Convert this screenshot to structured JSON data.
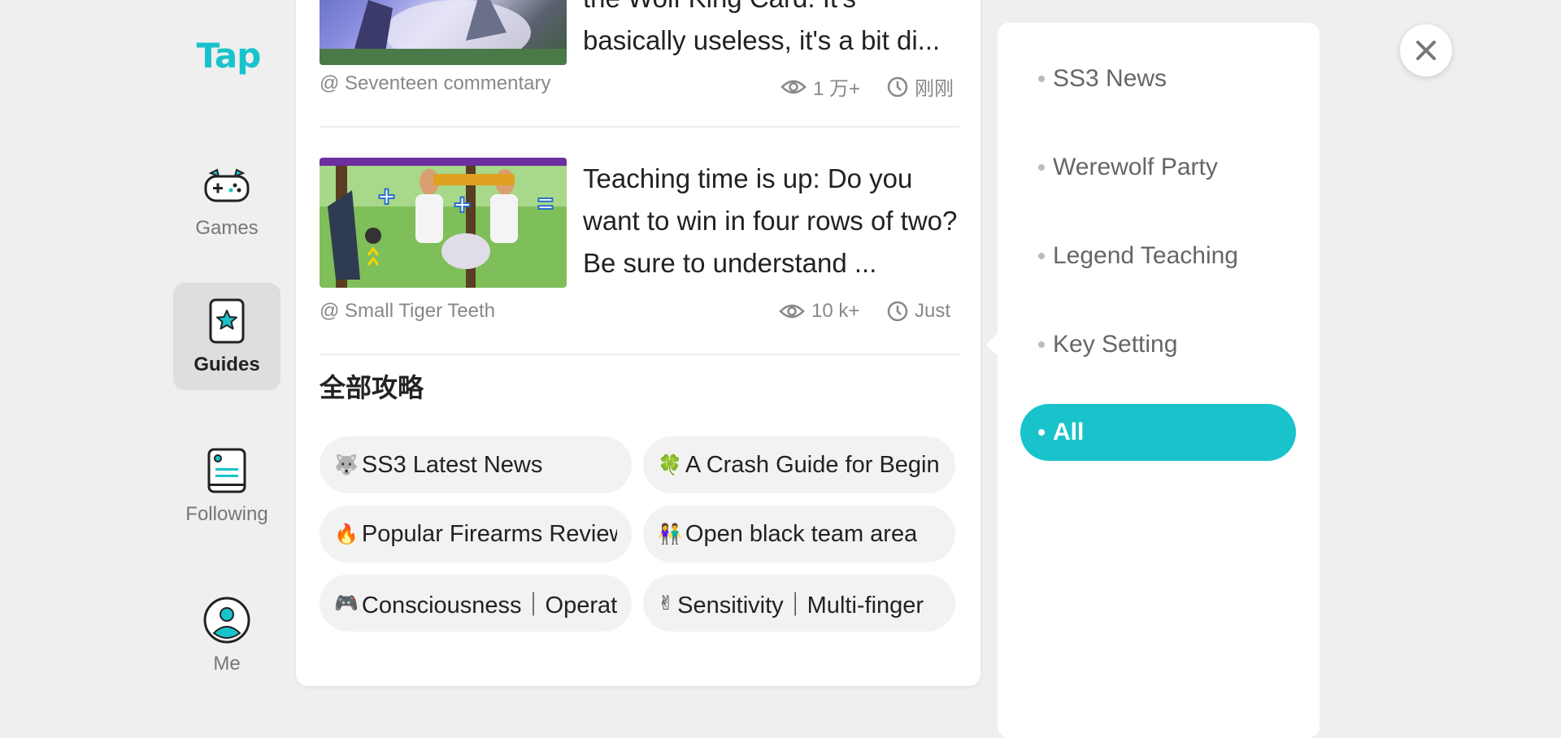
{
  "nav": {
    "logo": "Tap",
    "items": [
      {
        "label": "Games",
        "icon": "gamepad-icon"
      },
      {
        "label": "Guides",
        "icon": "guides-star-icon"
      },
      {
        "label": "Following",
        "icon": "following-list-icon"
      },
      {
        "label": "Me",
        "icon": "profile-icon"
      }
    ],
    "active": "Guides"
  },
  "articles": [
    {
      "title_line1": "the Wolf King Card.  It's",
      "title_line2": "basically useless, it's a bit di...",
      "author": "@ Seventeen commentary",
      "views": "1 万+",
      "time": "刚刚"
    },
    {
      "title": "Teaching time is up: Do you want to win in four rows of two?  Be sure to understand ...",
      "author": "@ Small Tiger Teeth",
      "views": "10 k+",
      "time": "Just"
    }
  ],
  "section": {
    "title": "全部攻略",
    "chips": [
      {
        "emoji": "🐺",
        "label": "SS3 Latest News"
      },
      {
        "emoji": "🍀",
        "label": " A Crash Guide for Beginners"
      },
      {
        "emoji": "🔥",
        "label": "Popular Firearms Review"
      },
      {
        "emoji": "👫",
        "label": " Open black team area"
      },
      {
        "emoji": "🎮",
        "label": " Consciousness｜Operation"
      },
      {
        "emoji": "✌",
        "label": "Sensitivity｜Multi-finger"
      }
    ]
  },
  "filter": {
    "options": [
      "SS3 News",
      "Werewolf Party",
      "Legend Teaching",
      "Key Setting"
    ],
    "active": "All"
  },
  "colors": {
    "accent": "#19c3cc",
    "background": "#efefef"
  }
}
